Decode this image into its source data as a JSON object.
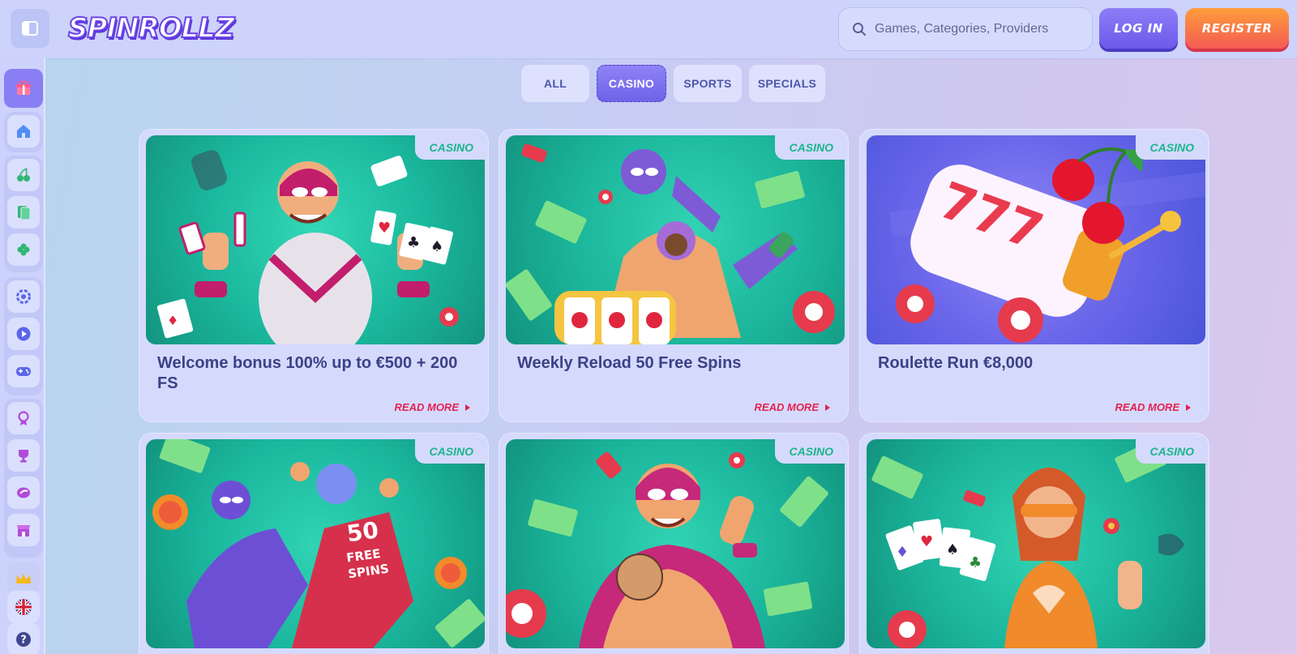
{
  "header": {
    "logo_text": "SPINROLLZ",
    "search_placeholder": "Games, Categories, Providers",
    "login_label": "LOG IN",
    "register_label": "REGISTER"
  },
  "sidebar": {
    "items": [
      {
        "name": "gift-icon"
      },
      {
        "name": "home-icon"
      },
      {
        "name": "cherry-icon"
      },
      {
        "name": "cards-icon"
      },
      {
        "name": "clover-icon"
      },
      {
        "name": "roulette-icon"
      },
      {
        "name": "play-icon"
      },
      {
        "name": "gamepad-icon"
      },
      {
        "name": "medal-icon"
      },
      {
        "name": "trophy-icon"
      },
      {
        "name": "bolt-icon"
      },
      {
        "name": "shop-icon"
      },
      {
        "name": "crown-icon"
      },
      {
        "name": "uk-flag-icon"
      },
      {
        "name": "help-icon"
      }
    ]
  },
  "tabs": [
    {
      "label": "ALL"
    },
    {
      "label": "CASINO"
    },
    {
      "label": "SPORTS"
    },
    {
      "label": "SPECIALS"
    }
  ],
  "active_tab": "CASINO",
  "cards": [
    {
      "badge": "CASINO",
      "title": "Welcome bonus 100% up to €500 + 200 FS",
      "read_more": "READ MORE"
    },
    {
      "badge": "CASINO",
      "title": "Weekly Reload 50 Free Spins",
      "read_more": "READ MORE"
    },
    {
      "badge": "CASINO",
      "title": "Roulette Run €8,000",
      "read_more": "READ MORE"
    },
    {
      "badge": "CASINO",
      "title": "",
      "read_more": ""
    },
    {
      "badge": "CASINO",
      "title": "",
      "read_more": ""
    },
    {
      "badge": "CASINO",
      "title": "",
      "read_more": ""
    }
  ],
  "card_art": {
    "card4_jersey_text": "50 FREE SPINS"
  },
  "colors": {
    "accent": "#6c59ea",
    "register": "#f35b54",
    "badge_green": "#1bb58c",
    "read_more_red": "#e5214f",
    "card_bg": "#d5dafc"
  }
}
